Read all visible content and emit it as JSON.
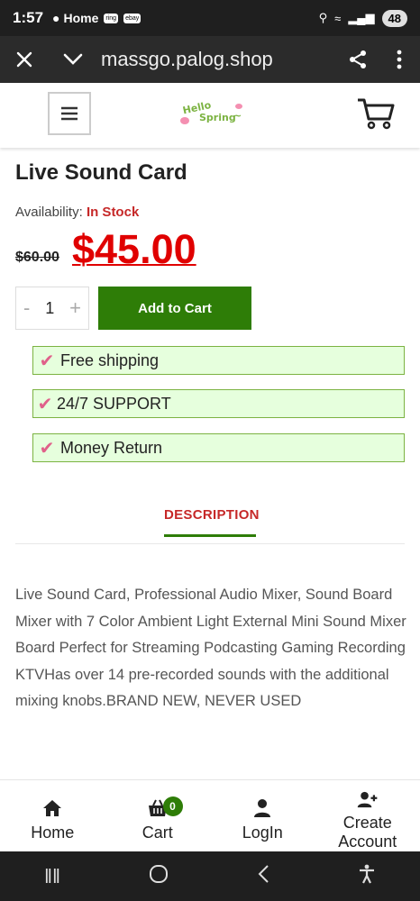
{
  "status": {
    "time": "1:57",
    "location_label": "Home",
    "battery": "48",
    "app_badges": [
      "ring",
      "ebay"
    ]
  },
  "browser": {
    "url": "massgo.palog.shop",
    "icons": [
      "close-icon",
      "chevron-down-icon",
      "share-icon",
      "more-icon"
    ]
  },
  "header": {
    "logo_text": "Hello Spring~",
    "menu_icon": "hamburger-icon",
    "cart_icon": "cart-icon"
  },
  "product": {
    "title": "Live Sound Card",
    "availability_label": "Availability:",
    "stock": "In Stock",
    "old_price": "$60.00",
    "new_price": "$45.00",
    "qty_minus": "-",
    "qty": "1",
    "qty_plus": "+",
    "add_to_cart": "Add to Cart"
  },
  "features": [
    "Free shipping",
    "24/7 SUPPORT",
    "Money Return"
  ],
  "tabs": {
    "description": "DESCRIPTION"
  },
  "description": "Live Sound Card, Professional Audio Mixer, Sound Board Mixer with 7 Color Ambient Light External Mini Sound Mixer Board Perfect for Streaming Podcasting Gaming Recording KTVHas over 14 pre-recorded sounds with the additional mixing knobs.BRAND NEW, NEVER USED",
  "bottom_nav": {
    "home": "Home",
    "cart": "Cart",
    "cart_count": "0",
    "login": "LogIn",
    "account": "Create Account"
  },
  "colors": {
    "accent_green": "#2e7d07",
    "price_red": "#e00000",
    "stock_red": "#c62828",
    "feature_bg": "#e6ffdd"
  }
}
